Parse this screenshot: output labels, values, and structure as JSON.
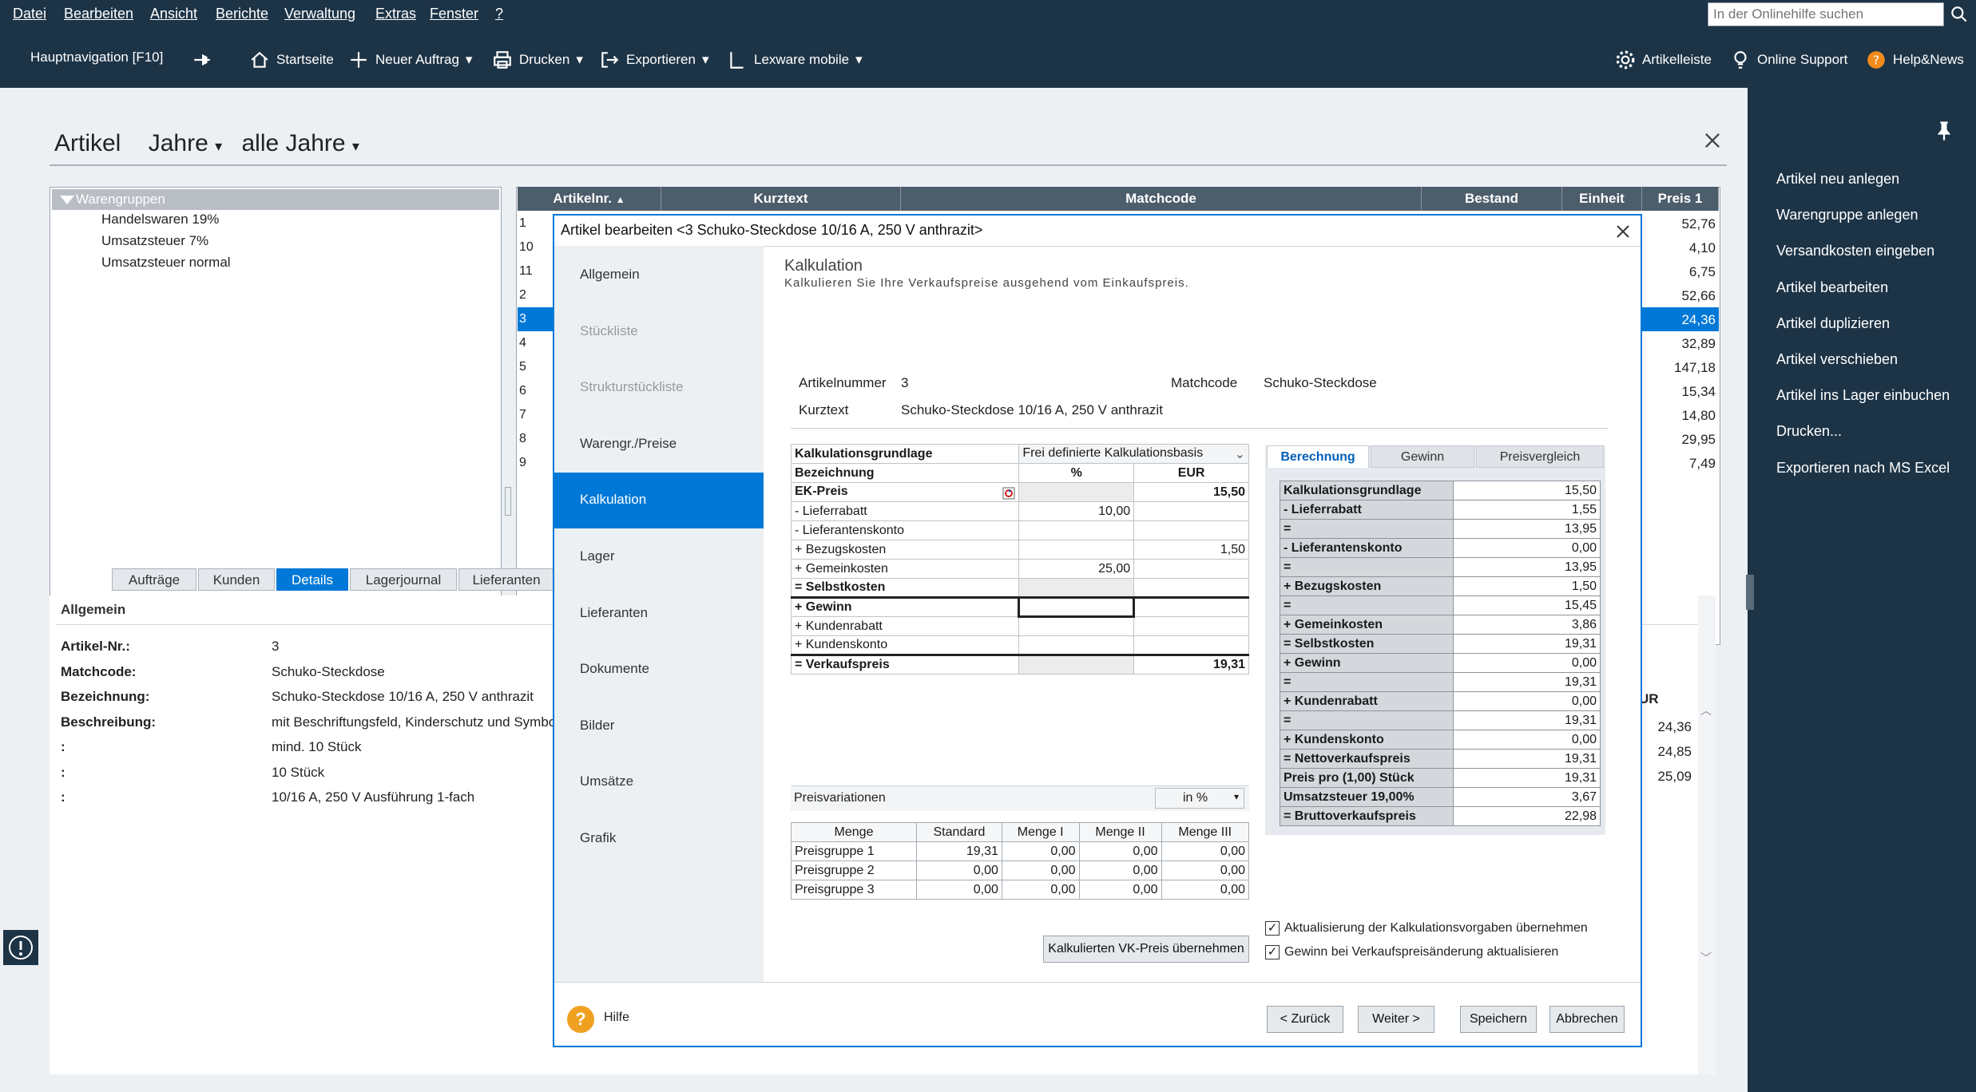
{
  "menu": [
    "Datei",
    "Bearbeiten",
    "Ansicht",
    "Berichte",
    "Verwaltung",
    "Extras",
    "Fenster",
    "?"
  ],
  "help_search_placeholder": "In der Onlinehilfe suchen",
  "toolbar": {
    "nav": "Hauptnavigation [F10]",
    "start": "Startseite",
    "new_order": "Neuer Auftrag",
    "print": "Drucken",
    "export": "Exportieren",
    "mobile": "Lexware mobile",
    "articlebar": "Artikelleiste",
    "support": "Online Support",
    "help_news": "Help&News"
  },
  "page": {
    "title": "Artikel",
    "year_label": "Jahre",
    "all_years": "alle Jahre"
  },
  "tree": {
    "head": "Warengruppen",
    "items": [
      "Handelswaren 19%",
      "Umsatzsteuer 7%",
      "Umsatzsteuer normal"
    ]
  },
  "grid": {
    "headers": [
      "Artikelnr.",
      "Kurztext",
      "Matchcode",
      "Bestand",
      "Einheit",
      "Preis 1"
    ],
    "numbers": [
      "1",
      "10",
      "11",
      "2",
      "3",
      "4",
      "5",
      "6",
      "7",
      "8",
      "9"
    ],
    "prices": [
      "52,76",
      "4,10",
      "6,75",
      "52,66",
      "24,36",
      "32,89",
      "147,18",
      "15,34",
      "14,80",
      "29,95",
      "7,49"
    ]
  },
  "tabs": [
    "Aufträge",
    "Kunden",
    "Details",
    "Lagerjournal",
    "Lieferanten"
  ],
  "details": {
    "title": "Allgemein",
    "rows": [
      {
        "k": "Artikel-Nr.:",
        "v": "3"
      },
      {
        "k": "Matchcode:",
        "v": "Schuko-Steckdose"
      },
      {
        "k": "Bezeichnung:",
        "v": "Schuko-Steckdose 10/16 A, 250 V anthrazit"
      },
      {
        "k": "Beschreibung:",
        "v": "mit Beschriftungsfeld, Kinderschutz und Symbol,"
      },
      {
        "k": ":",
        "v": "mind. 10 Stück"
      },
      {
        "k": ":",
        "v": "10 Stück"
      },
      {
        "k": ":",
        "v": "10/16 A, 250 V Ausführung 1-fach"
      }
    ],
    "right_head": "UR",
    "right_values": [
      "24,36",
      "24,85",
      "25,09"
    ]
  },
  "right_pane": [
    "Artikel neu anlegen",
    "Warengruppe anlegen",
    "Versandkosten eingeben",
    "Artikel bearbeiten",
    "Artikel duplizieren",
    "Artikel verschieben",
    "Artikel ins Lager einbuchen",
    "Drucken...",
    "Exportieren nach MS Excel"
  ],
  "dialog": {
    "title": "Artikel bearbeiten <3 Schuko-Steckdose 10/16 A, 250 V anthrazit>",
    "nav": [
      "Allgemein",
      "Stückliste",
      "Strukturstückliste",
      "Warengr./Preise",
      "Kalkulation",
      "Lager",
      "Lieferanten",
      "Dokumente",
      "Bilder",
      "Umsätze",
      "Grafik"
    ],
    "content_title": "Kalkulation",
    "content_sub": "Kalkulieren Sie Ihre Verkaufspreise ausgehend vom Einkaufspreis.",
    "artnr_label": "Artikelnummer",
    "artnr": "3",
    "matchcode_label": "Matchcode",
    "matchcode": "Schuko-Steckdose",
    "kurztext_label": "Kurztext",
    "kurztext": "Schuko-Steckdose 10/16 A, 250 V anthrazit",
    "calc": {
      "basis_label": "Kalkulationsgrundlage",
      "basis_value": "Frei definierte Kalkulationsbasis",
      "col_name": "Bezeichnung",
      "col_pct": "%",
      "col_eur": "EUR",
      "rows": [
        {
          "n": "EK-Preis",
          "p": "",
          "e": "15,50",
          "bold": true
        },
        {
          "n": "- Lieferrabatt",
          "p": "10,00",
          "e": ""
        },
        {
          "n": "- Lieferantenskonto",
          "p": "",
          "e": ""
        },
        {
          "n": "+ Bezugskosten",
          "p": "",
          "e": "1,50"
        },
        {
          "n": "+ Gemeinkosten",
          "p": "25,00",
          "e": ""
        },
        {
          "n": "= Selbstkosten",
          "p": "",
          "e": "",
          "bold": true
        },
        {
          "n": "+ Gewinn",
          "p": "",
          "e": "",
          "bold": true
        },
        {
          "n": "+ Kundenrabatt",
          "p": "",
          "e": ""
        },
        {
          "n": "+ Kundenskonto",
          "p": "",
          "e": ""
        },
        {
          "n": "= Verkaufspreis",
          "p": "",
          "e": "19,31",
          "bold": true
        }
      ]
    },
    "rtabs": [
      "Berechnung",
      "Gewinn",
      "Preisvergleich"
    ],
    "rcalc": [
      {
        "k": "Kalkulationsgrundlage",
        "v": "15,50"
      },
      {
        "k": "- Lieferrabatt",
        "v": "1,55"
      },
      {
        "k": "=",
        "v": "13,95"
      },
      {
        "k": "- Lieferantenskonto",
        "v": "0,00"
      },
      {
        "k": "=",
        "v": "13,95"
      },
      {
        "k": "+ Bezugskosten",
        "v": "1,50"
      },
      {
        "k": "=",
        "v": "15,45"
      },
      {
        "k": "+ Gemeinkosten",
        "v": "3,86"
      },
      {
        "k": "= Selbstkosten",
        "v": "19,31"
      },
      {
        "k": "+ Gewinn",
        "v": "0,00"
      },
      {
        "k": "=",
        "v": "19,31"
      },
      {
        "k": "+ Kundenrabatt",
        "v": "0,00"
      },
      {
        "k": "=",
        "v": "19,31"
      },
      {
        "k": "+ Kundenskonto",
        "v": "0,00"
      },
      {
        "k": "= Nettoverkaufspreis",
        "v": "19,31"
      },
      {
        "k": "Preis pro (1,00) Stück",
        "v": "19,31"
      },
      {
        "k": "Umsatzsteuer 19,00%",
        "v": "3,67"
      },
      {
        "k": "= Bruttoverkaufspreis",
        "v": "22,98"
      }
    ],
    "pv": {
      "label": "Preisvariationen",
      "unit": "in %",
      "headers": [
        "Menge",
        "Standard",
        "Menge I",
        "Menge II",
        "Menge III"
      ],
      "rows": [
        [
          "Preisgruppe 1",
          "19,31",
          "0,00",
          "0,00",
          "0,00"
        ],
        [
          "Preisgruppe 2",
          "0,00",
          "0,00",
          "0,00",
          "0,00"
        ],
        [
          "Preisgruppe 3",
          "0,00",
          "0,00",
          "0,00",
          "0,00"
        ]
      ]
    },
    "take_vk_button": "Kalkulierten VK-Preis übernehmen",
    "chk1": "Aktualisierung der Kalkulationsvorgaben übernehmen",
    "chk2": "Gewinn bei Verkaufspreisänderung aktualisieren",
    "help": "Hilfe",
    "back": "< Zurück",
    "next": "Weiter >",
    "save": "Speichern",
    "cancel": "Abbrechen"
  }
}
